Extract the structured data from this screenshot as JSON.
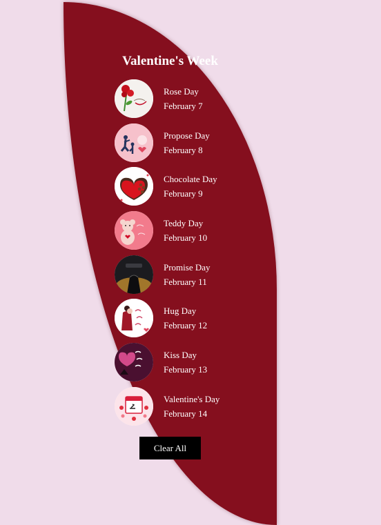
{
  "title": "Valentine's Week",
  "days": [
    {
      "name": "Rose Day",
      "date": "February 7",
      "icon": "rose-day-icon"
    },
    {
      "name": "Propose Day",
      "date": "February 8",
      "icon": "propose-day-icon"
    },
    {
      "name": "Chocolate Day",
      "date": "February 9",
      "icon": "chocolate-day-icon"
    },
    {
      "name": "Teddy Day",
      "date": "February 10",
      "icon": "teddy-day-icon"
    },
    {
      "name": "Promise Day",
      "date": "February 11",
      "icon": "promise-day-icon"
    },
    {
      "name": "Hug Day",
      "date": "February 12",
      "icon": "hug-day-icon"
    },
    {
      "name": "Kiss Day",
      "date": "February 13",
      "icon": "kiss-day-icon"
    },
    {
      "name": "Valentine's Day",
      "date": "February 14",
      "icon": "valentines-day-icon"
    }
  ],
  "clear_button": "Clear All",
  "colors": {
    "background": "#f0dcea",
    "panel": "#850f1e",
    "text": "#ffffff",
    "button": "#000000"
  }
}
